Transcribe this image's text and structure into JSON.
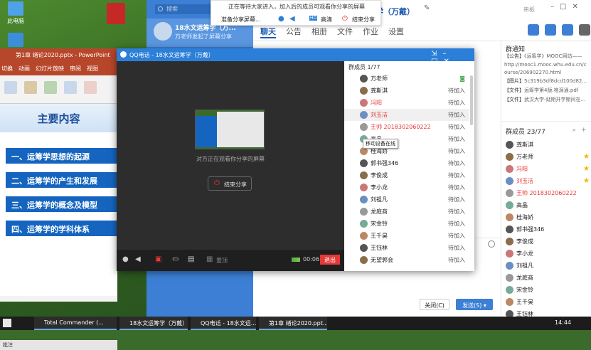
{
  "desktop": {
    "icons": [
      {
        "label": "此电脑",
        "icon": "computer-icon"
      },
      {
        "label": "",
        "icon": "app-icon"
      },
      {
        "label": "",
        "icon": "app-icon"
      }
    ]
  },
  "powerpoint": {
    "title": "第1章 绪论2020.pptx - PowerPoint",
    "tabs": [
      "切换",
      "动画",
      "幻灯片放映",
      "审阅",
      "视图"
    ],
    "slide_heading": "主要内容",
    "items": [
      "一、运筹学思想的起源",
      "二、运筹学的产生和发展",
      "三、运筹学的概念及模型",
      "四、运筹学的学科体系"
    ],
    "status_notes": "批注"
  },
  "qq_main": {
    "search_placeholder": "搜索",
    "conversation": {
      "name": "18水文运筹学（万...",
      "preview": "万老师发起了屏幕分享"
    },
    "group_title": "运筹学（万戴）",
    "header_hint": "串板",
    "tabs": [
      "聊天",
      "公告",
      "相册",
      "文件",
      "作业",
      "设置"
    ],
    "notice_title": "群通知",
    "notices": [
      {
        "tag": "【公告】",
        "text": "《运筹学》MOOC网站——"
      },
      {
        "tag": "",
        "text": "http://mooc1.mooc.whu.edu.cn/c"
      },
      {
        "tag": "",
        "text": "ourse/206902270.html"
      },
      {
        "tag": "【图片】",
        "text": "5c319b3df8dcd100d82..."
      },
      {
        "tag": "【文件】",
        "text": "运筹学第4版.袍源通.pdf"
      },
      {
        "tag": "【文件】",
        "text": "武汉大学-延期开学期间在..."
      }
    ],
    "members_title": "群成员 23/77",
    "members": [
      {
        "name": "龚斯淇",
        "red": false,
        "star": false
      },
      {
        "name": "万老师",
        "red": false,
        "star": true
      },
      {
        "name": "冯阳",
        "red": true,
        "star": true
      },
      {
        "name": "刘玉洁",
        "red": true,
        "star": true
      },
      {
        "name": "王帅 2018302060222",
        "red": true,
        "star": false
      },
      {
        "name": "高晶",
        "red": false,
        "star": false
      },
      {
        "name": "桂海娇",
        "red": false,
        "star": false
      },
      {
        "name": "郭书强346",
        "red": false,
        "star": false
      },
      {
        "name": "李俊成",
        "red": false,
        "star": false
      },
      {
        "name": "李小龙",
        "red": false,
        "star": false
      },
      {
        "name": "刘祖凡",
        "red": false,
        "star": false
      },
      {
        "name": "龙庭商",
        "red": false,
        "star": false
      },
      {
        "name": "宋金铃",
        "red": false,
        "star": false
      },
      {
        "name": "王千昊",
        "red": false,
        "star": false
      },
      {
        "name": "王钰林",
        "red": false,
        "star": false
      }
    ],
    "close_btn": "关闭(C)",
    "send_btn": "发送(S)"
  },
  "share_bar": {
    "message": "正在等待大家进入，加入后的成员可观看你分享的屏幕",
    "share_label": "准备分享屏幕...",
    "hd": "高清",
    "end": "结束分享"
  },
  "call": {
    "title": "QQ电话 - 18水文运筹学（万戴）",
    "watching": "对方正在观看你分享的屏幕",
    "end_share": "结束分享",
    "desktop_label": "置顶",
    "timer": "00:06",
    "exit": "退出",
    "members_title": "群成员 1/77",
    "tooltip": "移动设备在线",
    "members": [
      {
        "name": "万老师",
        "status": "",
        "red": false
      },
      {
        "name": "龚斯淇",
        "status": "待加入",
        "red": false
      },
      {
        "name": "冯阳",
        "status": "待加入",
        "red": true
      },
      {
        "name": "刘玉洁",
        "status": "待加入",
        "red": true
      },
      {
        "name": "王帅 2018302060222",
        "status": "待加入",
        "red": true
      },
      {
        "name": "高晶",
        "status": "待加入",
        "red": false
      },
      {
        "name": "桂海娇",
        "status": "待加入",
        "red": false
      },
      {
        "name": "郭书强346",
        "status": "待加入",
        "red": false
      },
      {
        "name": "李俊成",
        "status": "待加入",
        "red": false
      },
      {
        "name": "李小龙",
        "status": "待加入",
        "red": false
      },
      {
        "name": "刘祖凡",
        "status": "待加入",
        "red": false
      },
      {
        "name": "龙庭商",
        "status": "待加入",
        "red": false
      },
      {
        "name": "宋金铃",
        "status": "待加入",
        "red": false
      },
      {
        "name": "王千昊",
        "status": "待加入",
        "red": false
      },
      {
        "name": "王钰林",
        "status": "待加入",
        "red": false
      },
      {
        "name": "无望郭会",
        "status": "待加入",
        "red": false
      }
    ]
  },
  "taskbar": {
    "tasks": [
      "Total Commander (...",
      "18水文运筹学（万戴）...",
      "QQ电话 - 18水文运...",
      "第1章 绪论2020.ppt..."
    ],
    "clock": "14:44"
  }
}
